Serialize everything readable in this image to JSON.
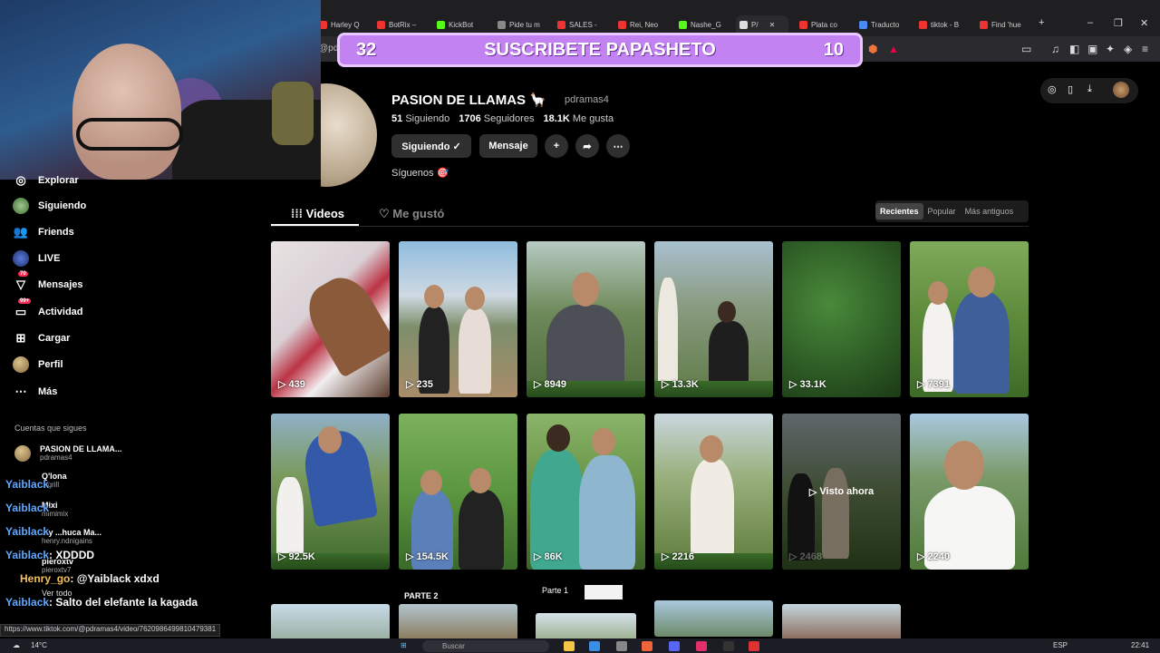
{
  "browser": {
    "tabs": [
      {
        "label": "Harley Q",
        "color": "#e33"
      },
      {
        "label": "BotRix –",
        "color": "#e33"
      },
      {
        "label": "KickBot",
        "color": "#53fc18"
      },
      {
        "label": "Pide tu m",
        "color": "#888"
      },
      {
        "label": "SALES -",
        "color": "#e33"
      },
      {
        "label": "Rei, Neo",
        "color": "#e33"
      },
      {
        "label": "Nashe_G",
        "color": "#53fc18"
      },
      {
        "label": "P/",
        "color": "#ddd"
      },
      {
        "label": "Plata co",
        "color": "#e33"
      },
      {
        "label": "Traducto",
        "color": "#4a8af4"
      },
      {
        "label": "tiktok - B",
        "color": "#e33"
      },
      {
        "label": "Find 'hue",
        "color": "#e33"
      }
    ],
    "url_fragment": "@pd",
    "window_controls": {
      "minimize": "–",
      "restore": "❐",
      "close": "✕",
      "new_tab": "+"
    },
    "hover_url": "https://www.tiktok.com/@pdramas4/video/7620986499810479381"
  },
  "overlay": {
    "banner_text": "SUSCRIBETE PAPASHETO",
    "banner_left": "32",
    "banner_right": "10"
  },
  "sidebar": {
    "items": [
      {
        "label": "Explorar",
        "icon": "compass-icon"
      },
      {
        "label": "Siguiendo",
        "icon": "following-avatar-icon"
      },
      {
        "label": "Friends",
        "icon": "friends-icon"
      },
      {
        "label": "LIVE",
        "icon": "live-icon"
      },
      {
        "label": "Mensajes",
        "icon": "inbox-icon",
        "badge": "70"
      },
      {
        "label": "Actividad",
        "icon": "activity-icon",
        "badge": "99+"
      },
      {
        "label": "Cargar",
        "icon": "upload-icon"
      },
      {
        "label": "Perfil",
        "icon": "profile-icon"
      },
      {
        "label": "Más",
        "icon": "more-icon"
      }
    ],
    "following_title": "Cuentas que sigues",
    "following": [
      {
        "name": "PASION DE LLAMA...",
        "handle": "pdramas4"
      },
      {
        "name": "Q'lona",
        "handle": "...grill"
      },
      {
        "name": "Mixi",
        "handle": "mimimix"
      },
      {
        "name": "...y ...huca Ma...",
        "handle": "henry.ndnigains"
      },
      {
        "name": "pieroxtv",
        "handle": "pieroxtv7"
      }
    ],
    "see_all": "Ver todo"
  },
  "chat": [
    {
      "user": "Yaiblack",
      "text": ""
    },
    {
      "user": "Yaiblack",
      "text": ""
    },
    {
      "user": "Yaiblack",
      "text": ""
    },
    {
      "user": "Yaiblack",
      "text": ": XDDDD"
    },
    {
      "user": "Henry_go",
      "text": ": @Yaiblack xdxd"
    },
    {
      "user": "Yaiblack",
      "text": ": Salto del elefante la kagada"
    }
  ],
  "profile": {
    "name": "PASION DE LLAMAS",
    "emoji": "🦙",
    "handle": "pdramas4",
    "following_count": "51",
    "following_label": "Siguiendo",
    "followers_count": "1706",
    "followers_label": "Seguidores",
    "likes_count": "18.1K",
    "likes_label": "Me gusta",
    "follow_btn": "Siguiendo ✓",
    "message_btn": "Mensaje",
    "bio": "Síguenos 🎯",
    "tab_videos": "Videos",
    "tab_liked": "Me gustó",
    "sort": [
      "Recientes",
      "Popular",
      "Más antiguos"
    ],
    "sort_selected": "Recientes"
  },
  "videos": [
    {
      "views": "439"
    },
    {
      "views": "235"
    },
    {
      "views": "8949"
    },
    {
      "views": "13.3K"
    },
    {
      "views": "33.1K"
    },
    {
      "views": "7391"
    },
    {
      "views": "92.5K"
    },
    {
      "views": "154.5K"
    },
    {
      "views": "86K"
    },
    {
      "views": "2216"
    },
    {
      "views": "2468",
      "watched": "Visto ahora"
    },
    {
      "views": "2240"
    }
  ],
  "row3_labels": {
    "parte2": "PARTE 2",
    "parte1": "Parte 1"
  },
  "taskbar": {
    "weather": "14°C",
    "search": "Buscar",
    "lang": "ESP",
    "time": "22:41"
  }
}
